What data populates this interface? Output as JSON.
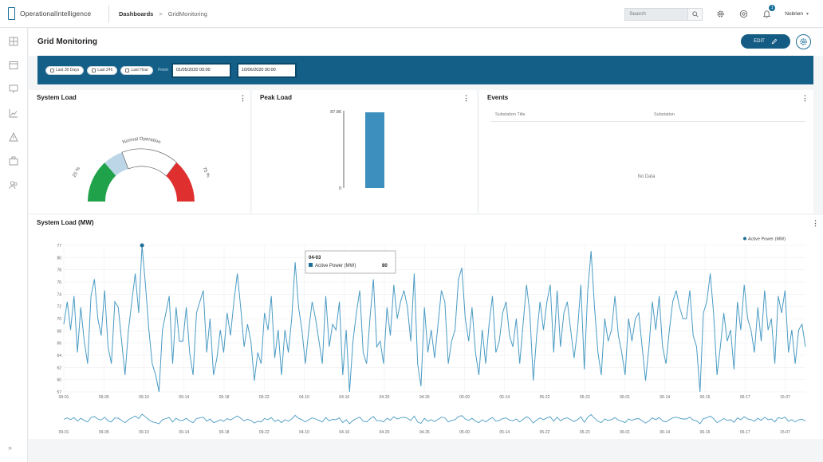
{
  "app": {
    "name": "OperationalIntelligence"
  },
  "breadcrumb": {
    "parent": "Dashboards",
    "separator": ">",
    "current": "GridMonitoring"
  },
  "search": {
    "placeholder": "Search"
  },
  "notifications": {
    "count": "1"
  },
  "user": {
    "name": "Nobrien"
  },
  "page": {
    "title": "Grid Monitoring",
    "edit_label": "EDIT"
  },
  "filters": {
    "chips": [
      "Last 30 Days",
      "Last 24h",
      "Last Hour"
    ],
    "from_label": "From",
    "start": "01/05/2020 00:00",
    "end": "10/06/2020 00:00"
  },
  "panels": {
    "system_load": {
      "title": "System Load",
      "arc_label": "Normal Operation",
      "left_label": "25 %",
      "right_label": "75 %"
    },
    "peak_load": {
      "title": "Peak Load"
    },
    "events": {
      "title": "Events",
      "columns": [
        "Substation Title",
        "Substation"
      ],
      "empty_text": "No Data"
    },
    "system_load_mw": {
      "title": "System Load (MW)"
    }
  },
  "colors": {
    "accent": "#135f88",
    "series": "#4a9bc4",
    "gauge_green": "#1fa24a",
    "gauge_red": "#e02f2f",
    "gauge_light": "#bcd6e8"
  },
  "chart_data": [
    {
      "type": "bar",
      "title": "Peak Load",
      "categories": [
        ""
      ],
      "values": [
        87.86
      ],
      "y_tick_labels": [
        "87.86",
        "0"
      ],
      "ylim": [
        0,
        87.86
      ]
    },
    {
      "type": "line",
      "title": "System Load (MW)",
      "legend": "top-right",
      "grid": true,
      "series": [
        {
          "name": "Active Power (MW)",
          "values": [
            67,
            71,
            66,
            72,
            62,
            70,
            64,
            60,
            72,
            75,
            68,
            65,
            73,
            63,
            60,
            71,
            70,
            64,
            58,
            66,
            71,
            76,
            69,
            81,
            74,
            66,
            60,
            58,
            55,
            66,
            69,
            72,
            60,
            70,
            64,
            64,
            70,
            62,
            58,
            69,
            71,
            73,
            62,
            68,
            58,
            61,
            66,
            62,
            69,
            65,
            71,
            76,
            70,
            63,
            67,
            64,
            57,
            62,
            60,
            69,
            66,
            72,
            61,
            66,
            58,
            66,
            62,
            68,
            78,
            70,
            66,
            60,
            66,
            71,
            68,
            64,
            60,
            72,
            63,
            67,
            66,
            71,
            58,
            66,
            55,
            64,
            69,
            73,
            62,
            60,
            68,
            75,
            63,
            64,
            60,
            70,
            65,
            74,
            68,
            71,
            73,
            70,
            64,
            76,
            60,
            56,
            70,
            62,
            66,
            61,
            67,
            73,
            71,
            60,
            64,
            66,
            75,
            77,
            68,
            64,
            70,
            62,
            58,
            66,
            60,
            67,
            72,
            62,
            64,
            69,
            71,
            65,
            63,
            68,
            60,
            67,
            74,
            69,
            57,
            65,
            71,
            66,
            71,
            74,
            62,
            73,
            63,
            69,
            71,
            66,
            61,
            66,
            74,
            59,
            73,
            80,
            70,
            62,
            58,
            68,
            64,
            66,
            72,
            65,
            62,
            58,
            68,
            64,
            68,
            69,
            63,
            57,
            63,
            71,
            66,
            72,
            63,
            60,
            66,
            71,
            73,
            70,
            68,
            68,
            73,
            65,
            63,
            55,
            69,
            71,
            76,
            69,
            58,
            63,
            69,
            64,
            66,
            59,
            71,
            66,
            74,
            68,
            66,
            62,
            70,
            64,
            73,
            66,
            68,
            60,
            72,
            69,
            73,
            62,
            66,
            60,
            66,
            67,
            63
          ]
        }
      ],
      "y_ticks": [
        "77",
        "80",
        "78",
        "76",
        "74",
        "72",
        "70",
        "68",
        "66",
        "64",
        "62",
        "60",
        "57"
      ],
      "x_ticks": [
        "09-01",
        "09-05",
        "09-10",
        "09-14",
        "09-18",
        "09-22",
        "04-10",
        "04-16",
        "04-20",
        "04-26",
        "05-09",
        "05-14",
        "05-22",
        "05-23",
        "06-01",
        "06-14",
        "06-16",
        "06-17",
        "15-07"
      ],
      "tooltip": {
        "title": "04-03",
        "series": "Active Power (MW)",
        "value": "80"
      }
    }
  ]
}
